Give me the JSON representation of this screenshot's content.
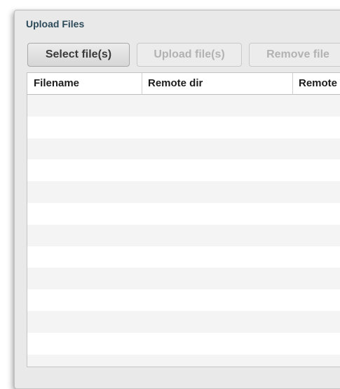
{
  "dialog": {
    "title": "Upload Files"
  },
  "toolbar": {
    "select_label": "Select file(s)",
    "upload_label": "Upload file(s)",
    "remove_label": "Remove file"
  },
  "table": {
    "columns": [
      "Filename",
      "Remote dir",
      "Remote"
    ],
    "rows": []
  },
  "colors": {
    "title": "#2c4a5a",
    "disabled_text": "#b2b2b2",
    "row_alt": "#f4f4f4"
  }
}
